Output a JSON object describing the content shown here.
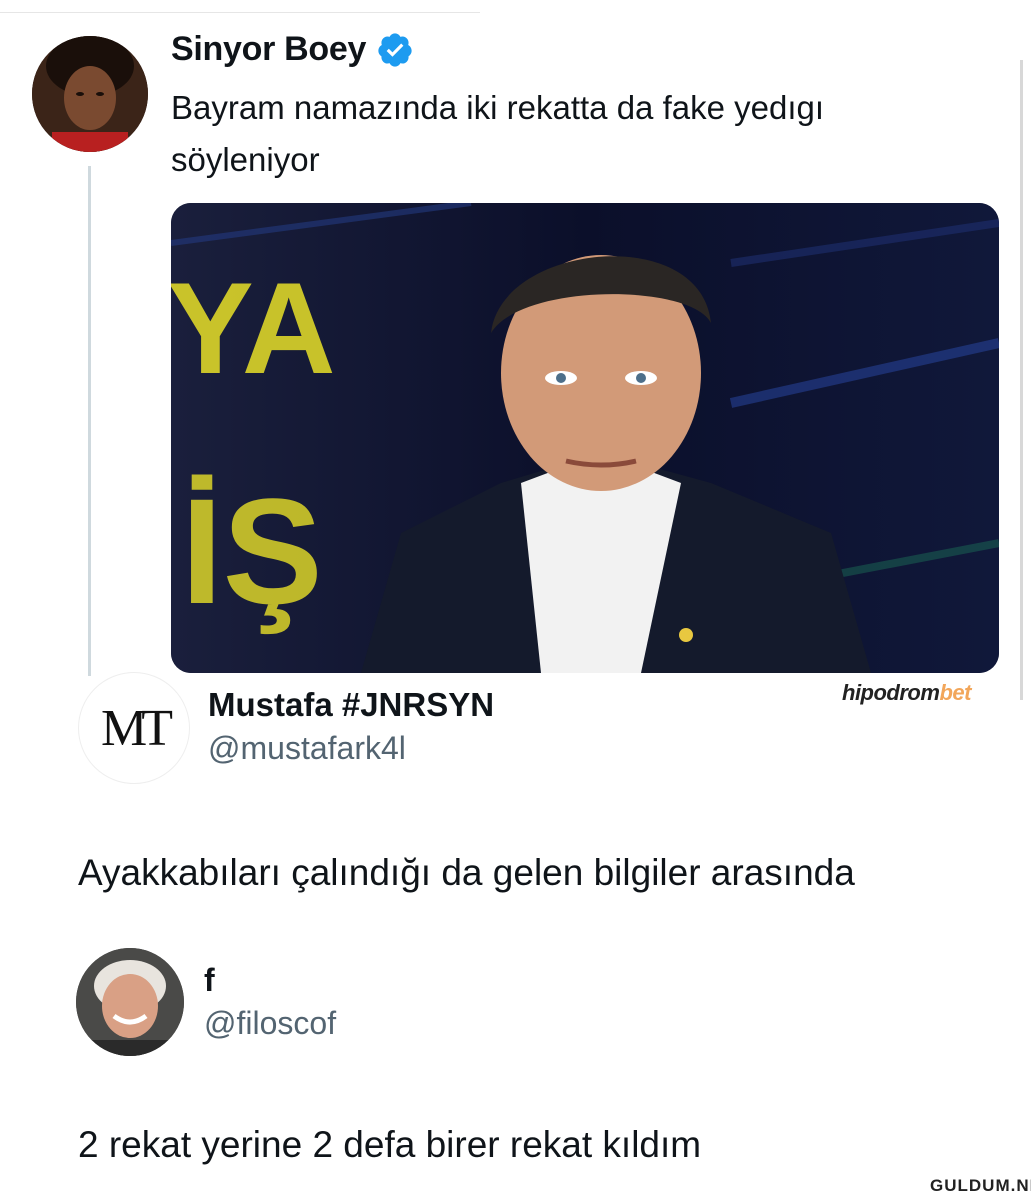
{
  "tweet1": {
    "author": "Sinyor Boey",
    "verified": true,
    "text_line1": "Bayram namazında iki rekatta da fake yedıgı",
    "text_line2": "söyleniyor",
    "photo_bg_letters_1": "YA",
    "photo_bg_letters_2": "İŞ",
    "photo_watermark": "hipodrom",
    "photo_watermark_accent": "bet"
  },
  "tweet2": {
    "avatar_initials": "MT",
    "author": "Mustafa #JNRSYN",
    "handle": "@mustafark4l",
    "text": "Ayakkabıları çalındığı da gelen bilgiler arasında"
  },
  "tweet3": {
    "author": "f",
    "handle": "@filoscof",
    "text": "2 rekat yerine 2 defa birer rekat kıldım"
  },
  "site_watermark": "GULDUM.NET",
  "colors": {
    "verified_blue": "#1d9bf0",
    "handle_gray": "#536471",
    "thread_line": "#cfd9de",
    "photo_yellow": "#e8e028"
  }
}
